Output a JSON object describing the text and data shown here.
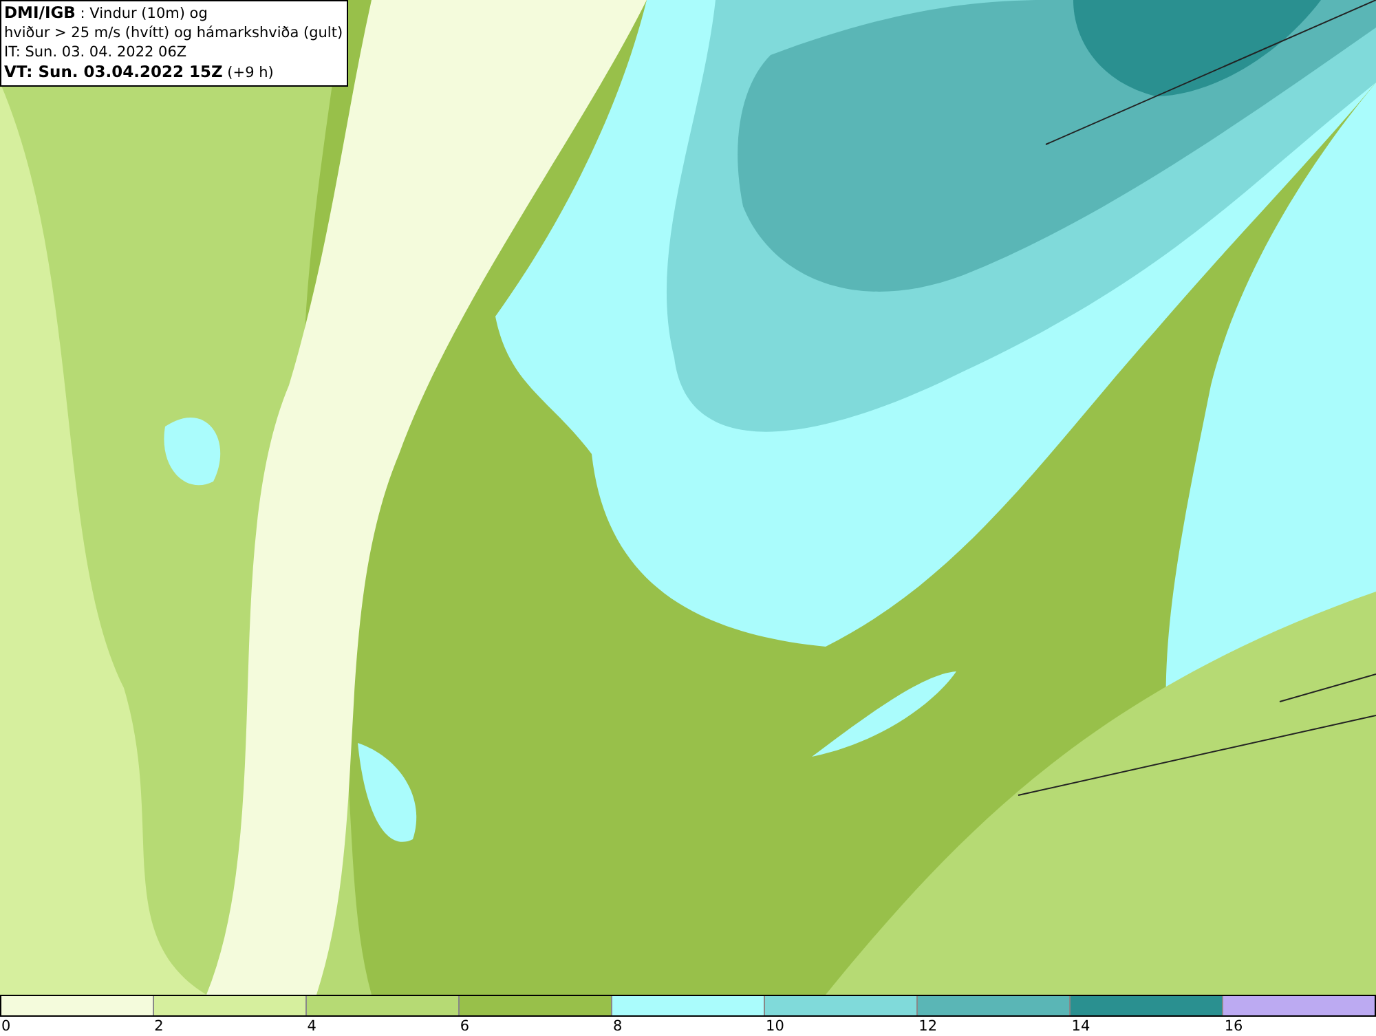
{
  "header": {
    "lines": [
      "**DMI/IGB** : Vindur (10m) og",
      "hviður > 25 m/s (hvítt) og hámarkshviða (gult)",
      "IT: Sun. 03. 04. 2022 06Z",
      "**VT: Sun. 03.04.2022 15Z** (+9 h)"
    ]
  },
  "legend": {
    "segments": [
      {
        "color": "#f4fbdc"
      },
      {
        "color": "#d6ef9e"
      },
      {
        "color": "#b6da74"
      },
      {
        "color": "#98c04a"
      },
      {
        "color": "#aafcfc"
      },
      {
        "color": "#80dada"
      },
      {
        "color": "#5ab6b6"
      },
      {
        "color": "#2a9090"
      },
      {
        "color": "#bcaaf2"
      }
    ],
    "ticks": [
      "0",
      "2",
      "4",
      "6",
      "8",
      "10",
      "12",
      "14",
      "16"
    ]
  }
}
